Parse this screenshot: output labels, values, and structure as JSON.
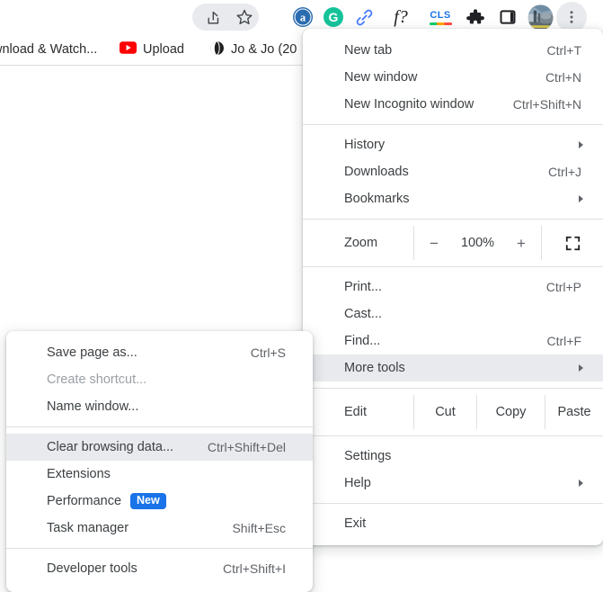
{
  "toolbar": {
    "icons": [
      {
        "name": "share-icon",
        "glyph": "share"
      },
      {
        "name": "bookmark-star-icon",
        "glyph": "star"
      },
      {
        "name": "amazon-extension-icon",
        "glyph": "a"
      },
      {
        "name": "grammarly-extension-icon",
        "glyph": "G"
      },
      {
        "name": "link-extension-icon",
        "glyph": "link"
      },
      {
        "name": "function-extension-icon",
        "glyph": "f?"
      },
      {
        "name": "cls-extension-icon",
        "glyph": "CLS"
      },
      {
        "name": "extensions-puzzle-icon",
        "glyph": "puzzle"
      },
      {
        "name": "side-panel-icon",
        "glyph": "panel"
      },
      {
        "name": "profile-avatar",
        "glyph": "photo"
      },
      {
        "name": "chrome-menu-icon",
        "glyph": "kebab"
      }
    ],
    "cls_label": "CLS",
    "function_label": "f?",
    "amazon_label": "a",
    "grammarly_label": "G"
  },
  "bookmarks": [
    {
      "label": "wnload & Watch...",
      "icon": "none"
    },
    {
      "label": "Upload",
      "icon": "youtube"
    },
    {
      "label": "Jo & Jo (20",
      "icon": "globe"
    }
  ],
  "main_menu": {
    "items": [
      {
        "label": "New tab",
        "accel": "Ctrl+T",
        "type": "item"
      },
      {
        "label": "New window",
        "accel": "Ctrl+N",
        "type": "item"
      },
      {
        "label": "New Incognito window",
        "accel": "Ctrl+Shift+N",
        "type": "item"
      },
      {
        "type": "separator"
      },
      {
        "label": "History",
        "accel": "",
        "type": "submenu"
      },
      {
        "label": "Downloads",
        "accel": "Ctrl+J",
        "type": "item"
      },
      {
        "label": "Bookmarks",
        "accel": "",
        "type": "submenu"
      },
      {
        "type": "separator"
      },
      {
        "type": "zoom"
      },
      {
        "type": "separator"
      },
      {
        "label": "Print...",
        "accel": "Ctrl+P",
        "type": "item"
      },
      {
        "label": "Cast...",
        "accel": "",
        "type": "item"
      },
      {
        "label": "Find...",
        "accel": "Ctrl+F",
        "type": "item"
      },
      {
        "label": "More tools",
        "accel": "",
        "type": "submenu",
        "highlighted": true
      },
      {
        "type": "separator"
      },
      {
        "type": "edit"
      },
      {
        "type": "separator"
      },
      {
        "label": "Settings",
        "accel": "",
        "type": "item"
      },
      {
        "label": "Help",
        "accel": "",
        "type": "submenu"
      },
      {
        "type": "separator"
      },
      {
        "label": "Exit",
        "accel": "",
        "type": "item"
      }
    ],
    "zoom_row": {
      "label": "Zoom",
      "minus": "−",
      "value": "100%",
      "plus": "+",
      "fullscreen_icon": "fullscreen-icon"
    },
    "edit_row": {
      "label": "Edit",
      "cut": "Cut",
      "copy": "Copy",
      "paste": "Paste"
    }
  },
  "more_tools_menu": {
    "items": [
      {
        "label": "Save page as...",
        "accel": "Ctrl+S",
        "type": "item"
      },
      {
        "label": "Create shortcut...",
        "accel": "",
        "type": "item",
        "disabled": true
      },
      {
        "label": "Name window...",
        "accel": "",
        "type": "item"
      },
      {
        "type": "separator"
      },
      {
        "label": "Clear browsing data...",
        "accel": "Ctrl+Shift+Del",
        "type": "item",
        "highlighted": true
      },
      {
        "label": "Extensions",
        "accel": "",
        "type": "item"
      },
      {
        "label": "Performance",
        "accel": "",
        "type": "item",
        "badge": "New"
      },
      {
        "label": "Task manager",
        "accel": "Shift+Esc",
        "type": "item"
      },
      {
        "type": "separator"
      },
      {
        "label": "Developer tools",
        "accel": "Ctrl+Shift+I",
        "type": "item"
      }
    ]
  },
  "colors": {
    "badge_blue": "#1a73e8",
    "highlight_gray": "#e8eaed",
    "text": "#3c4043",
    "accel_text": "#5f6368",
    "disabled_text": "#9aa0a6",
    "separator": "#e0e0e0",
    "youtube_red": "#ff0000",
    "grammarly_green": "#15c39a",
    "amazon_blue": "#1a5fb4",
    "link_blue": "#4a7dff"
  }
}
